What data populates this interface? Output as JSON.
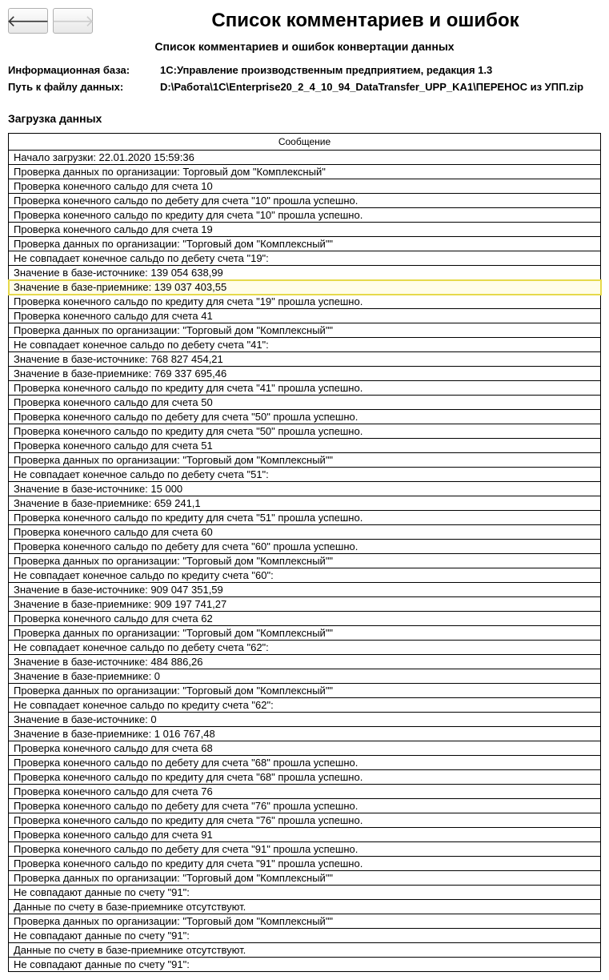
{
  "header": {
    "title": "Список комментариев и ошибок",
    "subtitle": "Список комментариев и ошибок конвертации данных"
  },
  "info": {
    "base_label": "Информационная база:",
    "base_value": "1С:Управление производственным предприятием, редакция 1.3",
    "path_label": "Путь к файлу данных:",
    "path_value": "D:\\Работа\\1С\\Enterprise20_2_4_10_94_DataTransfer_UPP_KA1\\ПЕРЕНОС из УПП.zip"
  },
  "section": "Загрузка данных",
  "table": {
    "column": "Сообщение",
    "highlight_index": 8,
    "rows": [
      "Начало загрузки: 22.01.2020 15:59:36",
      "Проверка данных по организации: Торговый дом \"Комплексный\"",
      "Проверка конечного сальдо для счета 10",
      "Проверка конечного сальдо по дебету для счета \"10\" прошла успешно.",
      "Проверка конечного сальдо по кредиту для счета \"10\" прошла успешно.",
      "Проверка конечного сальдо для счета 19",
      "Проверка данных по организации: \"Торговый дом \"Комплексный\"\"",
      "Не совпадает конечное сальдо по дебету счета \"19\":",
      "Значение в базе-источнике: 139 054 638,99",
      "Значение в базе-приемнике: 139 037 403,55",
      "Проверка конечного сальдо по кредиту для счета \"19\" прошла успешно.",
      "Проверка конечного сальдо для счета 41",
      "Проверка данных по организации: \"Торговый дом \"Комплексный\"\"",
      "Не совпадает конечное сальдо по дебету счета \"41\":",
      "Значение в базе-источнике: 768 827 454,21",
      "Значение в базе-приемнике: 769 337 695,46",
      "Проверка конечного сальдо по кредиту для счета \"41\" прошла успешно.",
      "Проверка конечного сальдо для счета 50",
      "Проверка конечного сальдо по дебету для счета \"50\" прошла успешно.",
      "Проверка конечного сальдо по кредиту для счета \"50\" прошла успешно.",
      "Проверка конечного сальдо для счета 51",
      "Проверка данных по организации: \"Торговый дом \"Комплексный\"\"",
      "Не совпадает конечное сальдо по дебету счета \"51\":",
      "Значение в базе-источнике: 15 000",
      "Значение в базе-приемнике: 659 241,1",
      "Проверка конечного сальдо по кредиту для счета \"51\" прошла успешно.",
      "Проверка конечного сальдо для счета 60",
      "Проверка конечного сальдо по дебету для счета \"60\" прошла успешно.",
      "Проверка данных по организации: \"Торговый дом \"Комплексный\"\"",
      "Не совпадает конечное сальдо по кредиту счета \"60\":",
      "Значение в базе-источнике: 909 047 351,59",
      "Значение в базе-приемнике: 909 197 741,27",
      "Проверка конечного сальдо для счета 62",
      "Проверка данных по организации: \"Торговый дом \"Комплексный\"\"",
      "Не совпадает конечное сальдо по дебету счета \"62\":",
      "Значение в базе-источнике: 484 886,26",
      "Значение в базе-приемнике: 0",
      "Проверка данных по организации: \"Торговый дом \"Комплексный\"\"",
      "Не совпадает конечное сальдо по кредиту счета \"62\":",
      "Значение в базе-источнике: 0",
      "Значение в базе-приемнике: 1 016 767,48",
      "Проверка конечного сальдо для счета 68",
      "Проверка конечного сальдо по дебету для счета \"68\" прошла успешно.",
      "Проверка конечного сальдо по кредиту для счета \"68\" прошла успешно.",
      "Проверка конечного сальдо для счета 76",
      "Проверка конечного сальдо по дебету для счета \"76\" прошла успешно.",
      "Проверка конечного сальдо по кредиту для счета \"76\" прошла успешно.",
      "Проверка конечного сальдо для счета 91",
      "Проверка конечного сальдо по дебету для счета \"91\" прошла успешно.",
      "Проверка конечного сальдо по кредиту для счета \"91\" прошла успешно.",
      "Проверка данных по организации: \"Торговый дом \"Комплексный\"\"",
      "Не совпадают данные по счету \"91\":",
      "Данные по счету в базе-приемнике отсутствуют.",
      "Проверка данных по организации: \"Торговый дом \"Комплексный\"\"",
      "Не совпадают данные по счету \"91\":",
      "Данные по счету в базе-приемнике отсутствуют.",
      "Не совпадают данные по счету \"91\":"
    ]
  }
}
